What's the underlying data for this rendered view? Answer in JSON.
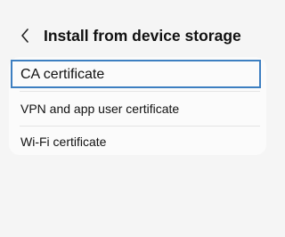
{
  "header": {
    "back_icon": "chevron-left-icon",
    "title": "Install from device storage"
  },
  "list": {
    "items": [
      {
        "label": "CA certificate",
        "focused": true
      },
      {
        "label": "VPN and app user certificate",
        "focused": false
      },
      {
        "label": "Wi-Fi certificate",
        "focused": false
      }
    ]
  },
  "colors": {
    "background": "#f5f5f5",
    "card": "#fbfbfb",
    "focus_border": "#3d7fc1",
    "text": "#111111"
  }
}
